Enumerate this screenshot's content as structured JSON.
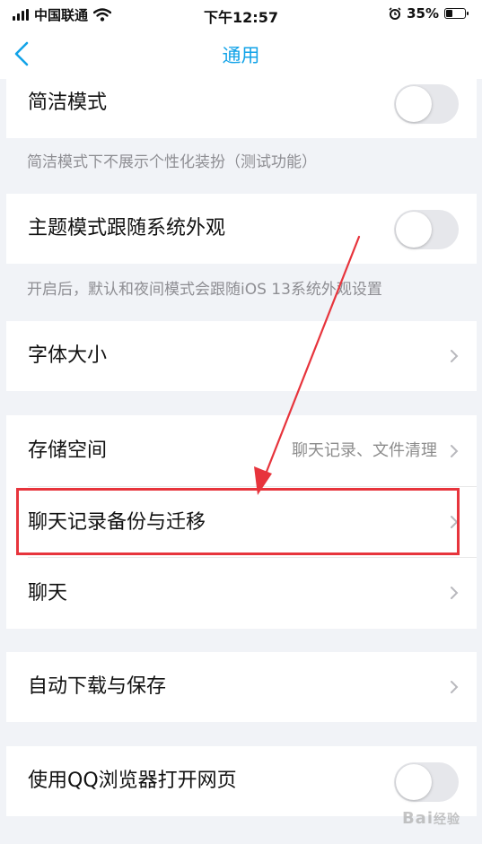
{
  "status_bar": {
    "carrier": "中国联通",
    "time": "下午12:57",
    "battery_percent_text": "35%",
    "battery_level": 0.35,
    "icons": [
      "signal-icon",
      "wifi-icon",
      "alarm-icon",
      "battery-icon"
    ]
  },
  "nav": {
    "title": "通用",
    "back_icon": "chevron-left-icon"
  },
  "accent_color": "#12a3e8",
  "annotation_color": "#e7343c",
  "settings": {
    "simple_mode": {
      "label": "简洁模式",
      "enabled": false,
      "hint": "简洁模式下不展示个性化装扮（测试功能）"
    },
    "theme_follow": {
      "label": "主题模式跟随系统外观",
      "enabled": false,
      "hint": "开启后，默认和夜间模式会跟随iOS 13系统外观设置"
    },
    "font_size": {
      "label": "字体大小"
    },
    "storage": {
      "label": "存储空间",
      "value": "聊天记录、文件清理"
    },
    "chat_backup": {
      "label": "聊天记录备份与迁移"
    },
    "chat": {
      "label": "聊天"
    },
    "auto_download": {
      "label": "自动下载与保存"
    },
    "qq_browser": {
      "label": "使用QQ浏览器打开网页",
      "enabled": false
    }
  },
  "watermark": {
    "text": "Bai经验"
  }
}
